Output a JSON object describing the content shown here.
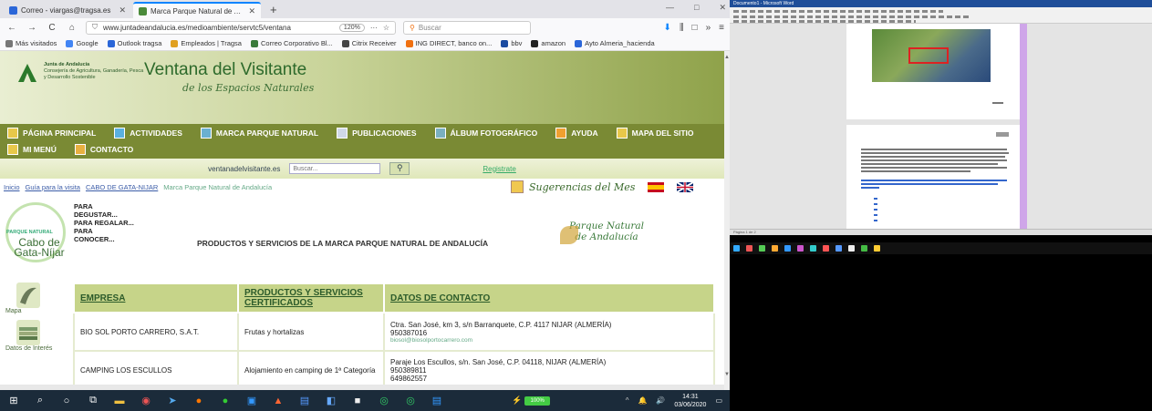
{
  "browser": {
    "tabs": [
      {
        "title": "Correo - viargas@tragsa.es",
        "close": "✕",
        "active": false,
        "color": "#2b66d8"
      },
      {
        "title": "Marca Parque Natural de Andalucía",
        "close": "✕",
        "active": true,
        "color": "#4a8a3a"
      }
    ],
    "new_tab": "+",
    "window_controls": [
      "—",
      "□",
      "✕"
    ],
    "nav": {
      "back": "←",
      "forward": "→",
      "reload": "C",
      "home": "⌂"
    },
    "url": "www.juntadeandalucia.es/medioambiente/servtc5/ventana",
    "zoom": "120%",
    "more": "···",
    "search_placeholder": "Buscar",
    "right_icons": [
      "⬇",
      "⫼",
      "□",
      "»",
      "≡"
    ],
    "bookmarks": [
      {
        "label": "Más visitados",
        "color": "#777"
      },
      {
        "label": "Google",
        "color": "#4285f4"
      },
      {
        "label": "Outlook tragsa",
        "color": "#2b66d8"
      },
      {
        "label": "Empleados | Tragsa",
        "color": "#e0a020"
      },
      {
        "label": "Correo Corporativo Bl...",
        "color": "#3a7a3a"
      },
      {
        "label": "Citrix Receiver",
        "color": "#444"
      },
      {
        "label": "ING DIRECT, banco on...",
        "color": "#f07010"
      },
      {
        "label": "bbv",
        "color": "#1a4aa0"
      },
      {
        "label": "amazon",
        "color": "#222"
      },
      {
        "label": "Ayto Almeria_hacienda",
        "color": "#2b66d8"
      }
    ]
  },
  "site": {
    "junta_name": "Junta de Andalucía",
    "junta_dept": "Consejería de Agricultura, Ganadería, Pesca y Desarrollo Sostenible",
    "title": "Ventana del Visitante",
    "subtitle": "de los Espacios Naturales",
    "menu": [
      "PÁGINA PRINCIPAL",
      "ACTIVIDADES",
      "MARCA PARQUE NATURAL",
      "PUBLICACIONES",
      "ÁLBUM FOTOGRÁFICO",
      "AYUDA",
      "MAPA DEL SITIO",
      "MI MENÚ",
      "CONTACTO"
    ],
    "portal_label": "ventanadelvisitante.es",
    "portal_search_placeholder": "Buscar...",
    "register": "Registrate",
    "breadcrumbs": [
      "Inicio",
      "Guía para la visita",
      "CABO DE GATA-NIJAR"
    ],
    "breadcrumb_current": "Marca Parque Natural de Andalucía",
    "suggestions": "Sugerencias del Mes",
    "park_label": "PARQUE NATURAL",
    "park_name": "Cabo de Gata-Níjar",
    "para_items": [
      "PARA",
      "DEGUSTAR...",
      "PARA REGALAR...",
      "PARA",
      "CONOCER..."
    ],
    "products_title": "PRODUCTOS Y SERVICIOS DE LA MARCA PARQUE NATURAL DE ANDALUCÍA",
    "pn_andalucia": "Parque Natural de Andalucía",
    "sidebar": [
      "Mapa",
      "Datos de Interés"
    ],
    "table_headers": [
      "EMPRESA",
      "PRODUCTOS Y SERVICIOS CERTIFICADOS",
      "DATOS DE CONTACTO"
    ],
    "rows": [
      {
        "empresa": "BIO SOL PORTO CARRERO, S.A.T.",
        "producto": "Frutas y hortalizas",
        "contacto": "Ctra. San José, km 3, s/n Barranquete, C.P. 4117 NIJAR (ALMERÍA)",
        "tel": "950387016",
        "email": "biosol@biosolportocarrero.com"
      },
      {
        "empresa": "CAMPING LOS ESCULLOS",
        "producto": "Alojamiento en camping de 1ª Categoría",
        "contacto": "Paraje Los Escullos, s/n. San José, C.P. 04118, NIJAR (ALMERÍA)",
        "tel": "950389811",
        "email": "649862557"
      }
    ]
  },
  "taskbar": {
    "start": "⊞",
    "search": "⌕",
    "battery": "100%",
    "tray": [
      "^",
      "🔔",
      "🔊"
    ],
    "time": "14:31",
    "date": "03/06/2020"
  },
  "doc": {
    "title_bar": "Documento1 - Microsoft Word",
    "status": "Página 1 de 2"
  }
}
